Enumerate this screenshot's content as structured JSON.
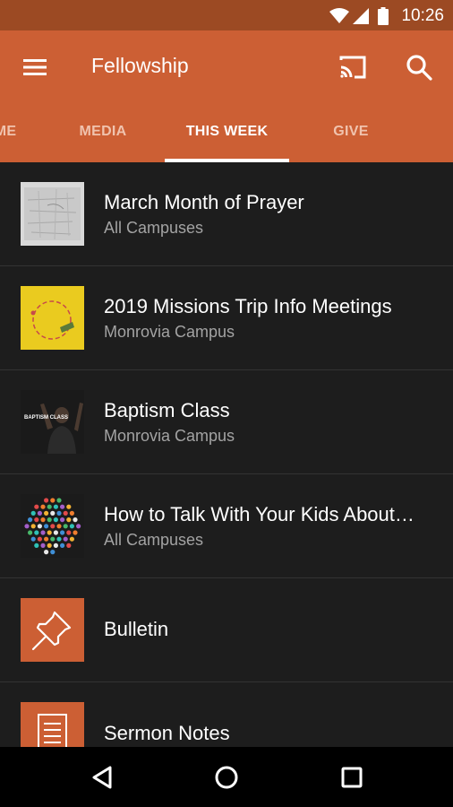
{
  "status_bar": {
    "time": "10:26"
  },
  "app_bar": {
    "title": "Fellowship"
  },
  "tabs": [
    {
      "label": "ME"
    },
    {
      "label": "MEDIA"
    },
    {
      "label": "THIS WEEK"
    },
    {
      "label": "GIVE"
    }
  ],
  "active_tab": "THIS WEEK",
  "items": [
    {
      "title": "March Month of Prayer",
      "subtitle": "All Campuses"
    },
    {
      "title": "2019 Missions Trip Info Meetings",
      "subtitle": "Monrovia Campus"
    },
    {
      "title": "Baptism Class",
      "subtitle": "Monrovia Campus",
      "thumb_text": "BAPTISM CLASS"
    },
    {
      "title": "How to Talk With Your Kids About…",
      "subtitle": "All Campuses"
    },
    {
      "title": "Bulletin"
    },
    {
      "title": "Sermon Notes"
    }
  ],
  "colors": {
    "primary": "#cc5f34",
    "status_bar": "#9c4a23",
    "background": "#1d1d1d",
    "missions_thumb": "#eacb1f"
  }
}
